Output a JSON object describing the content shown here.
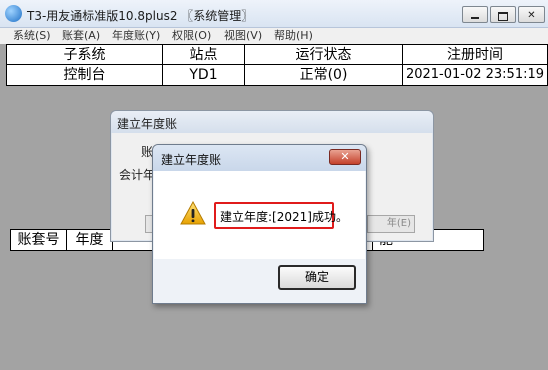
{
  "window": {
    "title": "T3-用友通标准版10.8plus2 〖系统管理〗",
    "buttons": {
      "minimize": "▭",
      "maximize": "◻",
      "close": "✕"
    }
  },
  "menu": [
    "系统(S)",
    "账套(A)",
    "年度账(Y)",
    "权限(O)",
    "视图(V)",
    "帮助(H)"
  ],
  "top_table": {
    "headers": [
      "子系统",
      "站点",
      "运行状态",
      "注册时间"
    ],
    "row": [
      "控制台",
      "YD1",
      "正常(0)",
      "2021-01-02 23:51:19"
    ]
  },
  "bottom_table": {
    "headers": [
      "账套号",
      "年度",
      "",
      "",
      "能"
    ]
  },
  "background_dialog": {
    "title": "建立年度账",
    "labels": [
      "账",
      "会计年"
    ],
    "button": "年(E)"
  },
  "dialog": {
    "title": "建立年度账",
    "message": "建立年度:[2021]成功。",
    "ok_label": "确定",
    "close_symbol": "✕"
  },
  "colors": {
    "highlight_border": "#e01b1b",
    "desktop": "#a3a3a3"
  }
}
